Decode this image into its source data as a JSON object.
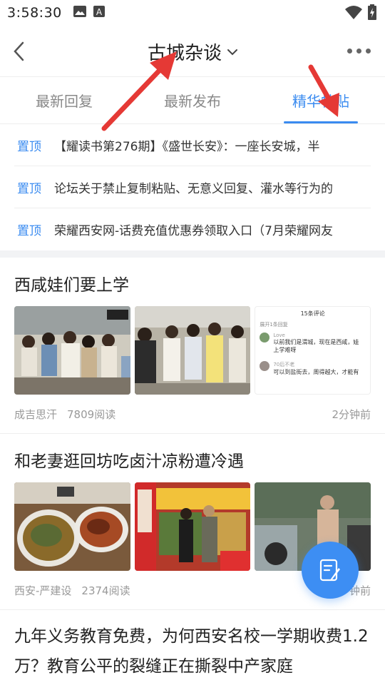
{
  "status_bar": {
    "time": "3:58:30"
  },
  "header": {
    "title": "古城杂谈"
  },
  "tabs": [
    {
      "label": "最新回复"
    },
    {
      "label": "最新发布"
    },
    {
      "label": "精华帖贴"
    }
  ],
  "pinned": {
    "badge": "置顶",
    "items": [
      {
        "title": "【耀读书第276期】《盛世长安》：一座长安城，半"
      },
      {
        "title": "论坛关于禁止复制粘贴、无意义回复、灌水等行为的"
      },
      {
        "title": "荣耀西安网-话费充值优惠券领取入口（7月荣耀网友"
      }
    ]
  },
  "posts": [
    {
      "title": "西咸娃们要上学",
      "author": "成吉思汗",
      "views": "7809阅读",
      "time": "2分钟前",
      "screenshot_text": {
        "header": "15条评论",
        "expand": "展开1条回复",
        "user1": "Love",
        "comment1": "以前我们是渭城，现在是西咸，娃上学难呀",
        "user2": "70后不老",
        "comment2": "可以到盐街去，周得越大，才能有"
      }
    },
    {
      "title": "和老妻逛回坊吃卤汁凉粉遭冷遇",
      "author": "西安-严建设",
      "views": "2374阅读",
      "time": "钟前"
    },
    {
      "title": "九年义务教育免费，为何西安名校一学期收费1.2万？教育公平的裂缝正在撕裂中产家庭"
    }
  ],
  "colors": {
    "accent": "#3a8bf0",
    "annotation_arrow": "#e53935"
  },
  "icons": [
    "back-icon",
    "chevron-down-icon",
    "more-icon",
    "image-icon",
    "notification-icon",
    "wifi-icon",
    "battery-icon",
    "compose-icon"
  ]
}
